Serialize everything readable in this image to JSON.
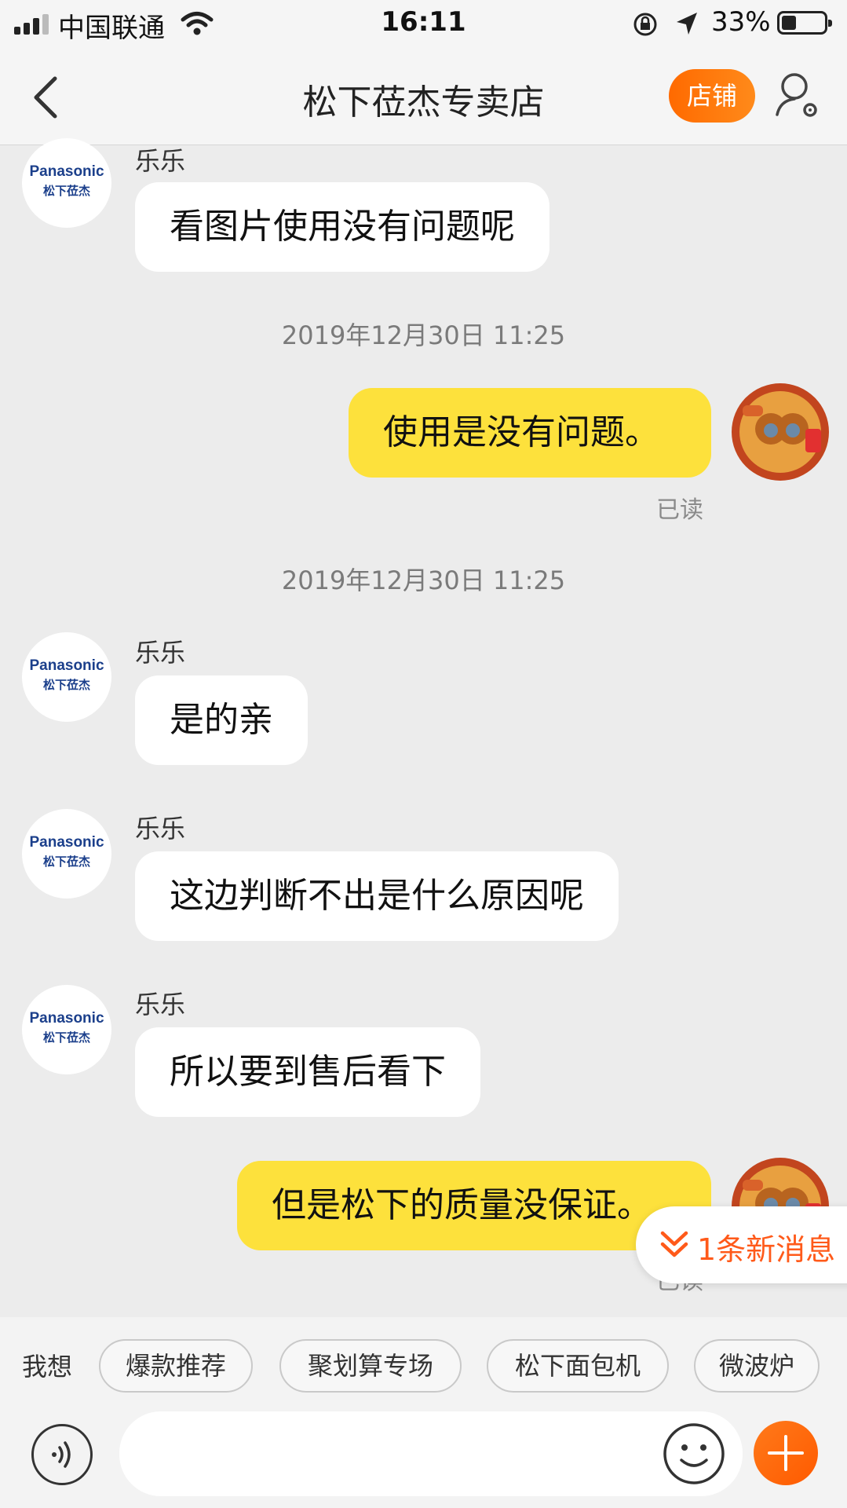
{
  "status_bar": {
    "carrier": "中国联通",
    "time": "16:11",
    "battery": "33%",
    "battery_level": 0.33
  },
  "nav": {
    "title": "松下莅杰专卖店",
    "shop_button": "店铺"
  },
  "messages": [
    {
      "side": "in",
      "sender": "乐乐",
      "text": "看图片使用没有问题呢",
      "avatar_brand": "Panasonic",
      "avatar_sub": "松下莅杰"
    },
    {
      "side": "timestamp",
      "text": "2019年12月30日 11:25"
    },
    {
      "side": "out",
      "text": "使用是没有问题。",
      "read": "已读"
    },
    {
      "side": "timestamp",
      "text": "2019年12月30日 11:25"
    },
    {
      "side": "in",
      "sender": "乐乐",
      "text": "是的亲",
      "avatar_brand": "Panasonic",
      "avatar_sub": "松下莅杰"
    },
    {
      "side": "in",
      "sender": "乐乐",
      "text": "这边判断不出是什么原因呢",
      "avatar_brand": "Panasonic",
      "avatar_sub": "松下莅杰"
    },
    {
      "side": "in",
      "sender": "乐乐",
      "text": "所以要到售后看下",
      "avatar_brand": "Panasonic",
      "avatar_sub": "松下莅杰"
    },
    {
      "side": "out",
      "text": "但是松下的质量没保证。",
      "read": "已读"
    }
  ],
  "new_message_notice": "1条新消息",
  "suggestions": {
    "label": "我想",
    "chips": [
      "爆款推荐",
      "聚划算专场",
      "松下面包机",
      "微波炉"
    ]
  },
  "input": {
    "placeholder": ""
  },
  "colors": {
    "accent": "#ff6a00",
    "out_bubble": "#fde13c",
    "background": "#ececec"
  }
}
